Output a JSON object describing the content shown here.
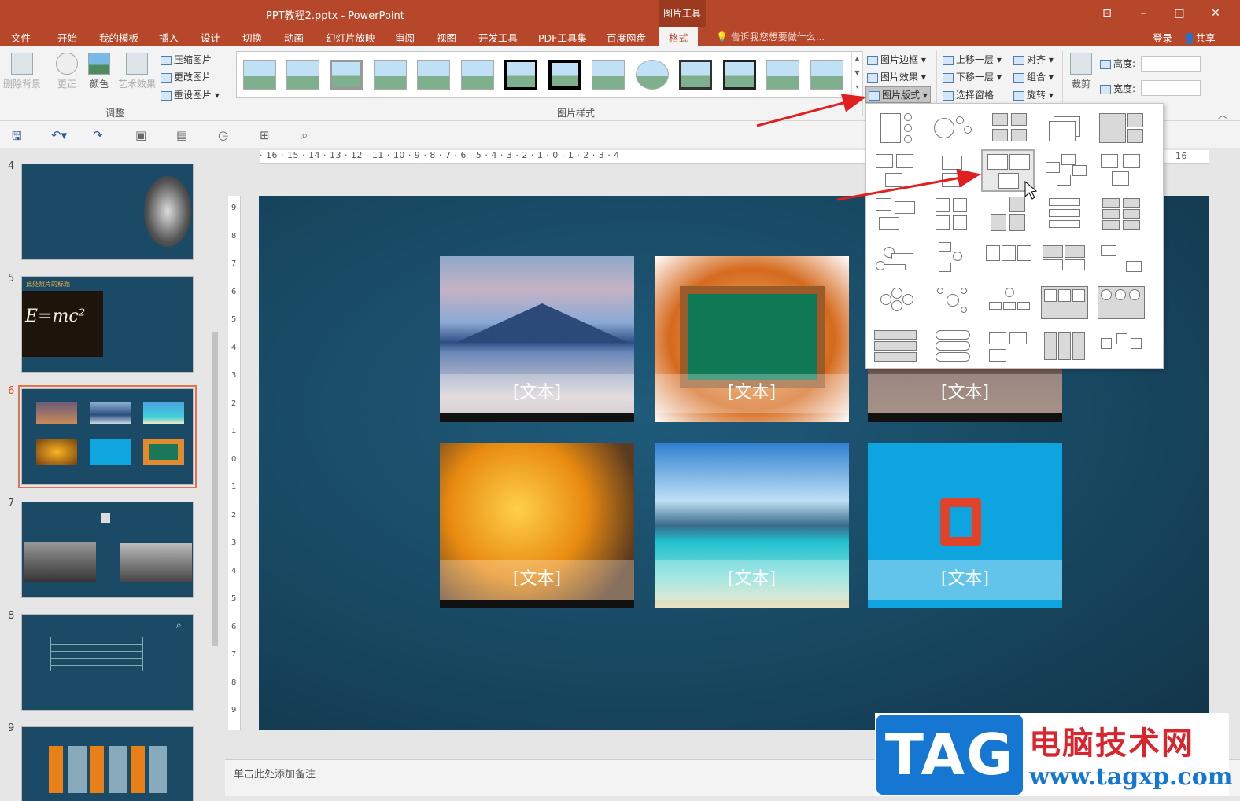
{
  "window": {
    "title": "PPT教程2.pptx - PowerPoint",
    "context_tab": "图片工具"
  },
  "menu": {
    "tabs": [
      "文件",
      "开始",
      "我的模板",
      "插入",
      "设计",
      "切换",
      "动画",
      "幻灯片放映",
      "审阅",
      "视图",
      "开发工具",
      "PDF工具集",
      "百度网盘",
      "格式"
    ],
    "active": "格式",
    "tell_me": "告诉我您想要做什么...",
    "login": "登录",
    "share": "共享"
  },
  "ribbon": {
    "adjust": {
      "remove_bg": "删除背景",
      "corrections": "更正",
      "color": "颜色",
      "artistic": "艺术效果",
      "compress": "压缩图片",
      "change": "更改图片",
      "reset": "重设图片",
      "label": "调整"
    },
    "styles_label": "图片样式",
    "picture_border": "图片边框",
    "picture_effects": "图片效果",
    "picture_layout": "图片版式",
    "bring_forward": "上移一层",
    "send_backward": "下移一层",
    "selection_pane": "选择窗格",
    "align": "对齐",
    "group": "组合",
    "rotate": "旋转",
    "crop": "裁剪",
    "height_label": "高度:",
    "width_label": "宽度:"
  },
  "ruler": {
    "h_ticks": "· 16 · 15 · 14 · 13 · 12 · 11 · 10 · 9 · 8 · 7 · 6 · 5 · 4 · 3 · 2 · 1 · 0 · 1 · 2 · 3 · 4",
    "h_right": "16"
  },
  "slides": [
    {
      "num": "4"
    },
    {
      "num": "5",
      "title": "此处照片的标题",
      "formula": "E=mc²"
    },
    {
      "num": "6",
      "selected": true
    },
    {
      "num": "7"
    },
    {
      "num": "8"
    },
    {
      "num": "9"
    }
  ],
  "slide": {
    "placeholder_texts": [
      "[文本]",
      "[文本]",
      "[文本]",
      "[文本]",
      "[文本]",
      "[文本]"
    ]
  },
  "notes": {
    "placeholder": "单击此处添加备注"
  },
  "watermark": {
    "tag": "TAG",
    "cn": "电脑技术网",
    "url": "www.tagxp.com"
  },
  "colors": {
    "accent": "#b7472a",
    "slide_bg": "#184862",
    "arrow": "#e02020"
  }
}
